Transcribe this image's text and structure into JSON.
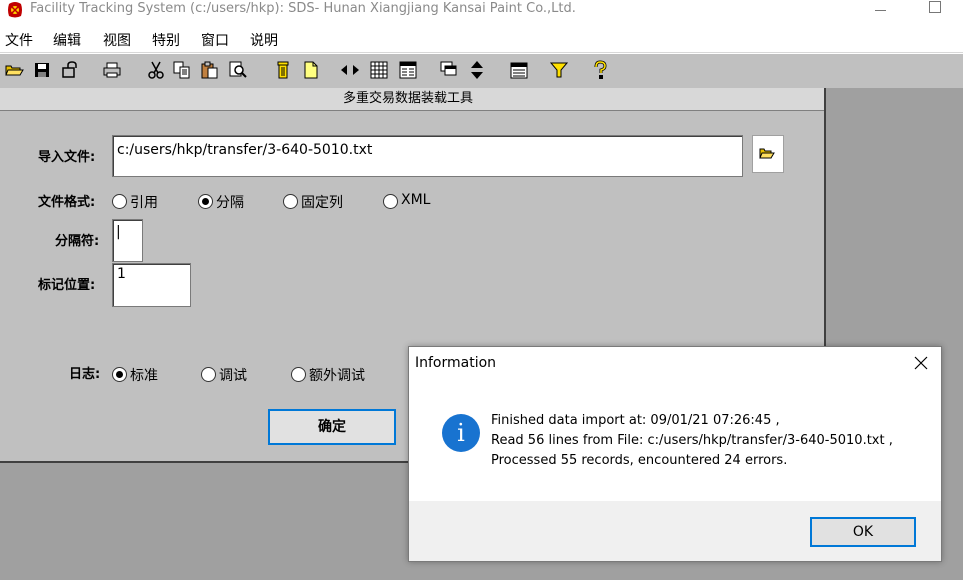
{
  "window": {
    "title": "Facility Tracking System (c:/users/hkp): SDS- Hunan Xiangjiang Kansai Paint Co.,Ltd."
  },
  "menu": [
    "文件",
    "编辑",
    "视图",
    "特别",
    "窗口",
    "说明"
  ],
  "toolbar": {
    "icons": [
      "open-folder-icon",
      "save-icon",
      "key-icon",
      "print-icon",
      "cut-icon",
      "copy-icon",
      "paste-icon",
      "find-icon",
      "trash-icon",
      "new-file-icon",
      "sort-lr-icon",
      "grid-icon",
      "form-icon",
      "cascade-icon",
      "sort-ud-icon",
      "calendar-icon",
      "filter-icon",
      "help-icon"
    ]
  },
  "form": {
    "title": "多重交易数据装载工具",
    "import_label": "导入文件:",
    "import_value": "c:/users/hkp/transfer/3-640-5010.txt",
    "format_label": "文件格式:",
    "format_options": [
      "引用",
      "分隔",
      "固定列",
      "XML"
    ],
    "format_selected": "分隔",
    "delimiter_label": "分隔符:",
    "delimiter_value": "|",
    "marker_label": "标记位置:",
    "marker_value": "1",
    "log_label": "日志:",
    "log_options": [
      "标准",
      "调试",
      "额外调试"
    ],
    "log_selected": "标准",
    "ok_label": "确定"
  },
  "dialog": {
    "title": "Information",
    "lines": [
      "Finished data import at: 09/01/21 07:26:45 ,",
      "Read 56 lines from File: c:/users/hkp/transfer/3-640-5010.txt ,",
      "Processed 55 records, encountered 24 errors."
    ],
    "ok_label": "OK",
    "icon_glyph": "i"
  }
}
